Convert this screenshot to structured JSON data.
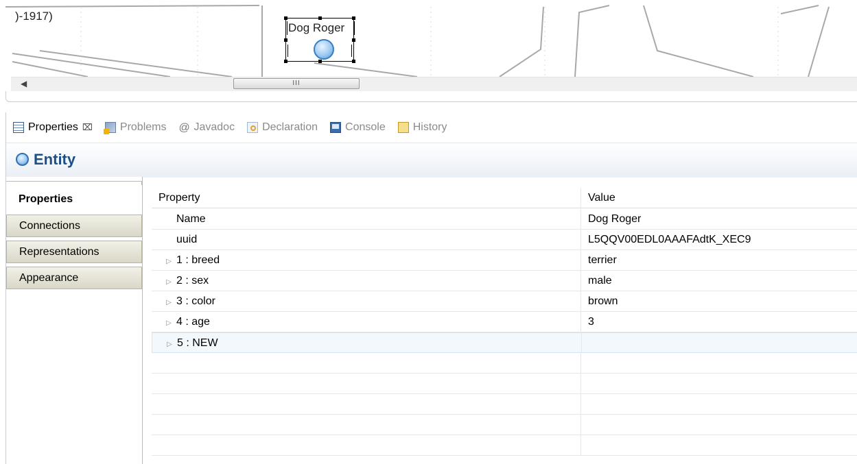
{
  "canvas": {
    "clipped_text": ")-1917)",
    "node_label": "Dog Roger",
    "scroll_grip": "III"
  },
  "tabs": [
    {
      "label": "Properties",
      "icon": "properties-icon",
      "active": true
    },
    {
      "label": "Problems",
      "icon": "problems-icon"
    },
    {
      "label": "Javadoc",
      "icon": "at-icon"
    },
    {
      "label": "Declaration",
      "icon": "declaration-icon"
    },
    {
      "label": "Console",
      "icon": "console-icon"
    },
    {
      "label": "History",
      "icon": "history-icon"
    }
  ],
  "entity_title": "Entity",
  "sections": [
    "Properties",
    "Connections",
    "Representations",
    "Appearance"
  ],
  "table": {
    "headers": {
      "property": "Property",
      "value": "Value"
    },
    "rows": [
      {
        "property": "Name",
        "value": "Dog Roger"
      },
      {
        "property": "uuid",
        "value": "L5QQV00EDL0AAAFAdtK_XEC9"
      },
      {
        "property": "1 : breed",
        "value": "terrier"
      },
      {
        "property": "2 : sex",
        "value": "male"
      },
      {
        "property": "3 : color",
        "value": "brown"
      },
      {
        "property": "4 : age",
        "value": "3"
      },
      {
        "property": "5 : NEW",
        "value": ""
      }
    ]
  },
  "colors": {
    "entity_title": "#1d4f87",
    "selection": "#f3f8fd"
  }
}
